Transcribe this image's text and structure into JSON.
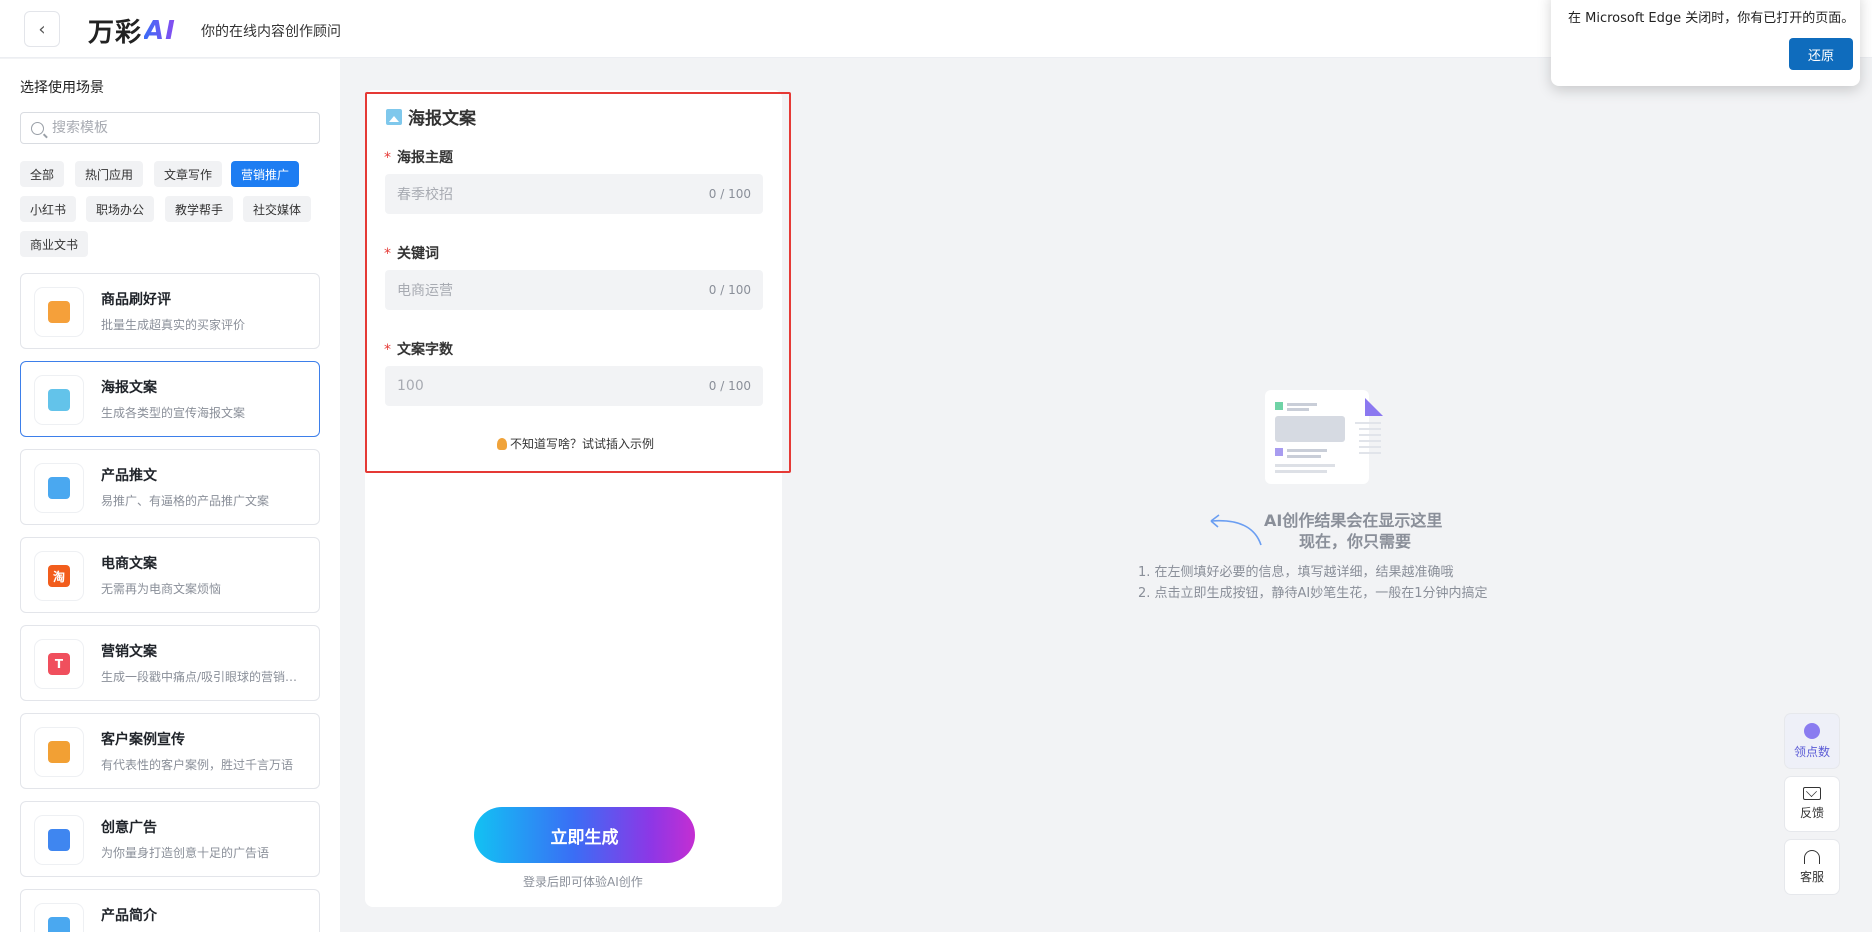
{
  "header": {
    "back_glyph": "‹",
    "logo_text": "万彩",
    "logo_ai": "AI",
    "tagline": "你的在线内容创作顾问"
  },
  "edge_popup": {
    "message": "在 Microsoft Edge 关闭时，你有已打开的页面。",
    "restore_label": "还原"
  },
  "sidebar": {
    "title": "选择使用场景",
    "search_placeholder": "搜索模板",
    "tags": [
      "全部",
      "热门应用",
      "文章写作",
      "营销推广",
      "小红书",
      "职场办公",
      "教学帮手",
      "社交媒体",
      "商业文书"
    ],
    "active_tag": "营销推广",
    "cards": [
      {
        "title": "商品刷好评",
        "desc": "批量生成超真实的买家评价",
        "icon": "shopping-bag-icon",
        "color": "#f5a03a",
        "glyph": ""
      },
      {
        "title": "海报文案",
        "desc": "生成各类型的宣传海报文案",
        "icon": "poster-image-icon",
        "color": "#63c3ea",
        "glyph": ""
      },
      {
        "title": "产品推文",
        "desc": "易推广、有逼格的产品推广文案",
        "icon": "calendar-icon",
        "color": "#4aa8f0",
        "glyph": ""
      },
      {
        "title": "电商文案",
        "desc": "无需再为电商文案烦恼",
        "icon": "taobao-icon",
        "color": "#f25d1c",
        "glyph": "淘"
      },
      {
        "title": "营销文案",
        "desc": "生成一段戳中痛点/吸引眼球的营销文案",
        "icon": "text-t-icon",
        "color": "#f04f5d",
        "glyph": "T"
      },
      {
        "title": "客户案例宣传",
        "desc": "有代表性的客户案例，胜过千言万语",
        "icon": "trophy-icon",
        "color": "#f2a034",
        "glyph": ""
      },
      {
        "title": "创意广告",
        "desc": "为你量身打造创意十足的广告语",
        "icon": "price-tag-icon",
        "color": "#3f86f0",
        "glyph": ""
      },
      {
        "title": "产品简介",
        "desc": "",
        "icon": "document-icon",
        "color": "#4aa8f0",
        "glyph": ""
      }
    ]
  },
  "form": {
    "title": "海报文案",
    "required_mark": "*",
    "fields": [
      {
        "label": "海报主题",
        "placeholder": "春季校招",
        "count": "0 / 100"
      },
      {
        "label": "关键词",
        "placeholder": "电商运营",
        "count": "0 / 100"
      },
      {
        "label": "文案字数",
        "placeholder": "100",
        "count": "0 / 100"
      }
    ],
    "hint": "不知道写啥？试试插入示例",
    "generate_label": "立即生成",
    "login_note": "登录后即可体验AI创作"
  },
  "result": {
    "line1": "AI创作结果会在显示这里",
    "line2": "现在，你只需要",
    "steps": [
      "1. 在左侧填好必要的信息，填写越详细，结果越准确哦",
      "2. 点击立即生成按钮，静待AI妙笔生花，一般在1分钟内搞定"
    ]
  },
  "float_buttons": {
    "points_label": "领点数",
    "feedback_label": "反馈",
    "service_label": "客服"
  }
}
